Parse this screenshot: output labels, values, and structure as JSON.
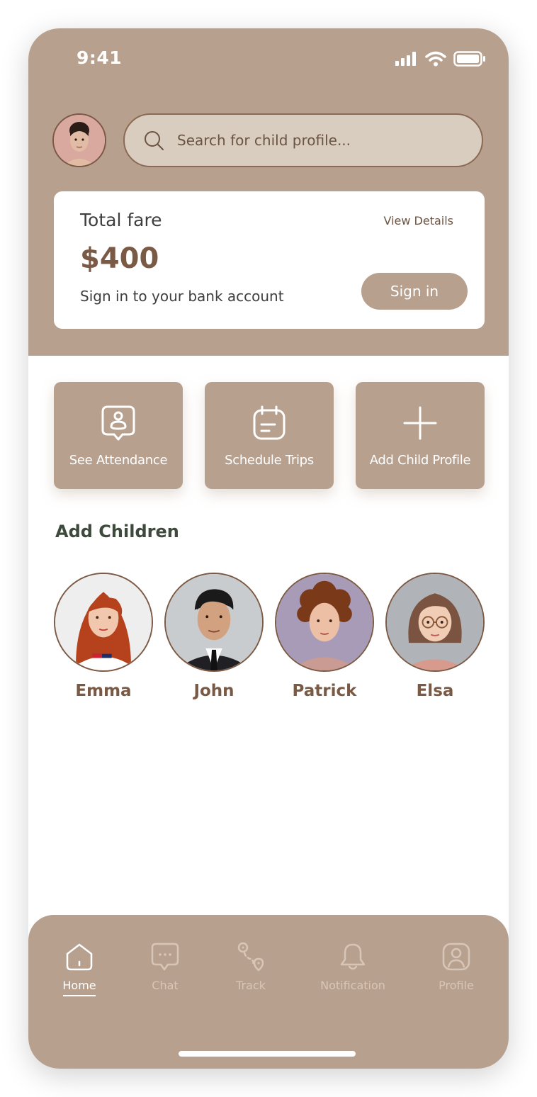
{
  "status_bar": {
    "time": "9:41"
  },
  "search": {
    "placeholder": "Search for child profile..."
  },
  "fare_card": {
    "label": "Total fare",
    "view_details": "View Details",
    "amount": "$400",
    "subtitle": "Sign in to your bank account",
    "signin_label": "Sign in"
  },
  "actions": [
    {
      "label": "See Attendance",
      "icon": "attendance-badge-icon"
    },
    {
      "label": "Schedule Trips",
      "icon": "calendar-icon"
    },
    {
      "label": "Add Child Profile",
      "icon": "plus-icon"
    }
  ],
  "children_section": {
    "title": "Add Children",
    "children": [
      {
        "name": "Emma"
      },
      {
        "name": "John"
      },
      {
        "name": "Patrick"
      },
      {
        "name": "Elsa"
      }
    ]
  },
  "tabbar": {
    "active": "Home",
    "tabs": [
      {
        "label": "Home",
        "icon": "home-icon"
      },
      {
        "label": "Chat",
        "icon": "chat-icon"
      },
      {
        "label": "Track",
        "icon": "route-icon"
      },
      {
        "label": "Notification",
        "icon": "bell-icon"
      },
      {
        "label": "Profile",
        "icon": "profile-icon"
      }
    ]
  },
  "colors": {
    "primary": "#b8a08e",
    "accent_text": "#7b5a45",
    "search_bg": "#d8cdbf",
    "heading": "#3d4a3c"
  }
}
